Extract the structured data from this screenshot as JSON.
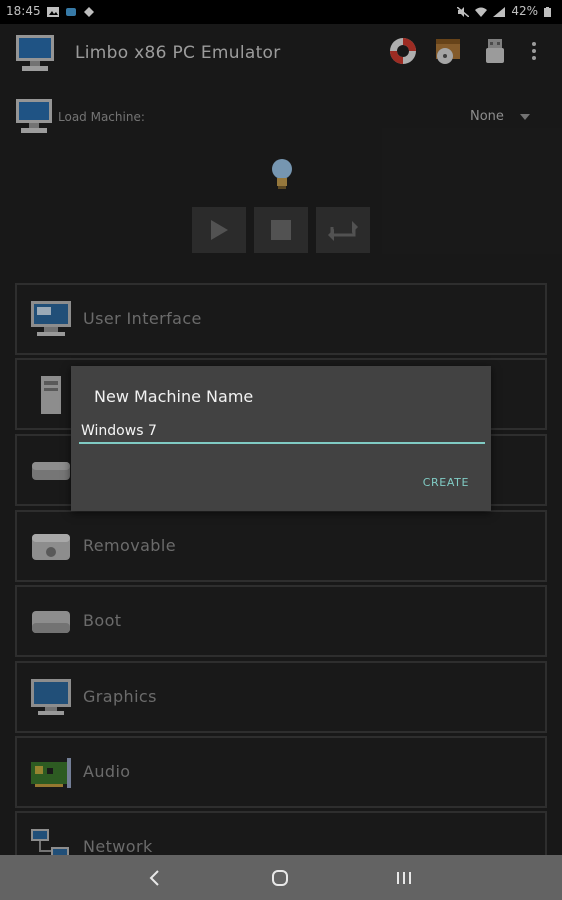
{
  "status_bar": {
    "time": "18:45",
    "battery": "42%"
  },
  "app_bar": {
    "title": "Limbo x86 PC Emulator"
  },
  "load_machine": {
    "label": "Load Machine:",
    "value": "None"
  },
  "sections": [
    {
      "label": "User Interface"
    },
    {
      "label": ""
    },
    {
      "label": ""
    },
    {
      "label": "Removable"
    },
    {
      "label": "Boot"
    },
    {
      "label": "Graphics"
    },
    {
      "label": "Audio"
    },
    {
      "label": "Network"
    }
  ],
  "dialog": {
    "title": "New Machine Name",
    "input_value": "Windows 7",
    "create_label": "CREATE"
  },
  "colors": {
    "accent": "#80cbc4",
    "background": "#212121",
    "dialog": "#424242"
  }
}
